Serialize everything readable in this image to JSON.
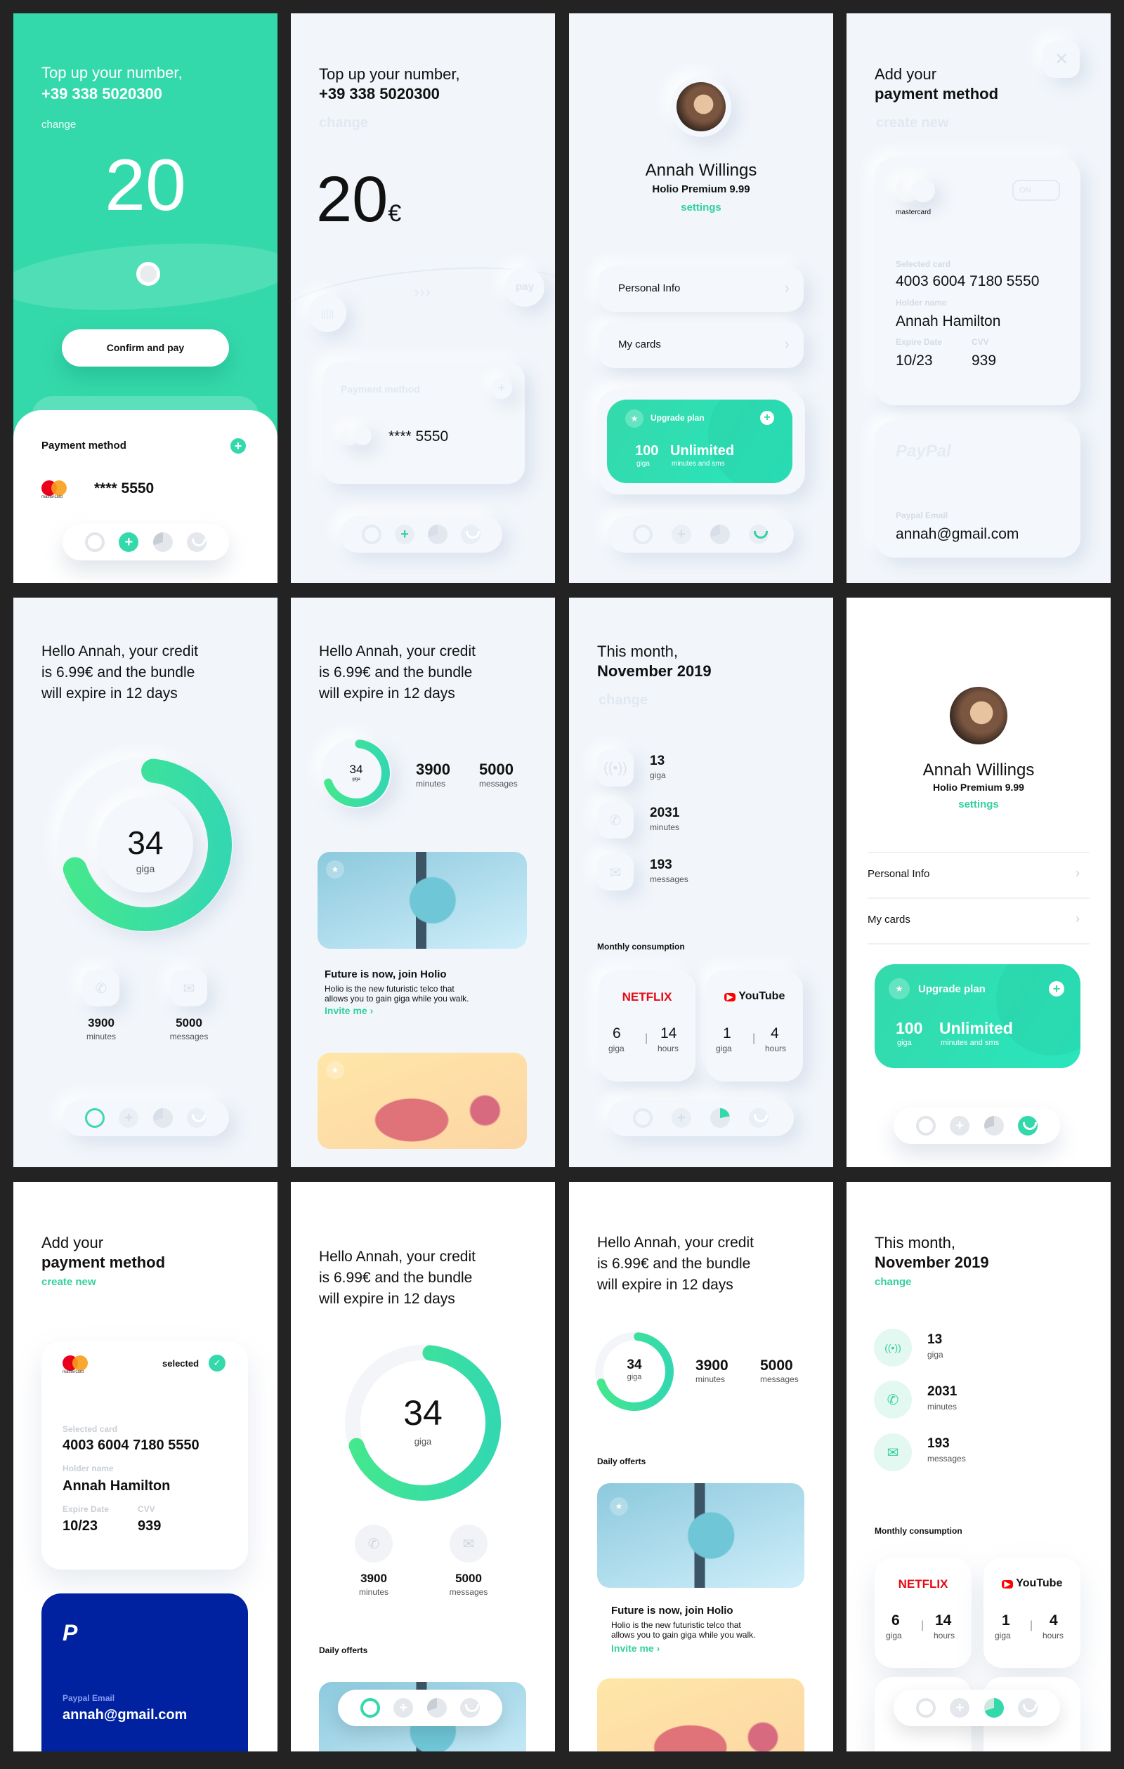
{
  "colors": {
    "accent": "#34d9ab",
    "accent_dark": "#34d0a0",
    "paypal": "#0022a0",
    "netflix": "#e50914",
    "youtube": "#ff0000",
    "background": "#f2f6fb"
  },
  "topup": {
    "title": "Top up your number,",
    "phone": "+39 338 5020300",
    "change": "change",
    "amount": "20",
    "currency": "€",
    "confirm": "Confirm and pay",
    "pay": "pay",
    "payment_method": "Payment method",
    "card_masked": "**** 5550",
    "mastercard": "mastercard"
  },
  "profile": {
    "name": "Annah Willings",
    "plan": "Holio Premium 9.99",
    "settings": "settings",
    "menu": [
      {
        "label": "Personal Info"
      },
      {
        "label": "My cards"
      }
    ],
    "upgrade": {
      "title": "Upgrade plan",
      "giga_value": "100",
      "giga_label": "giga",
      "unlimited": "Unlimited",
      "unlimited_label": "minutes and sms"
    }
  },
  "payment": {
    "title_light": "Add your",
    "title_bold": "payment method",
    "create_new": "create new",
    "mastercard": "mastercard",
    "toggle": "ON",
    "selected": "selected",
    "selected_card_label": "Selected card",
    "card_number": "4003 6004 7180 5550",
    "holder_label": "Holder name",
    "holder": "Annah Hamilton",
    "expire_label": "Expire Date",
    "expire": "10/23",
    "cvv_label": "CVV",
    "cvv": "939",
    "paypal_logo": "PayPal",
    "paypal_email_label": "Paypal Email",
    "paypal_email": "annah@gmail.com"
  },
  "home": {
    "greeting": {
      "l1": "Hello Annah, your credit",
      "l2a": "is ",
      "credit": "6.99€",
      "l2b": " and the bundle",
      "l3a": "will expire in ",
      "days": "12 days"
    },
    "giga": "34",
    "giga_label": "giga",
    "giga_fraction": 0.68,
    "minutes": "3900",
    "minutes_label": "minutes",
    "messages": "5000",
    "messages_label": "messages",
    "daily_offers": "Daily offerts",
    "offer": {
      "title": "Future is now, join Holio",
      "desc1": "Holio is the new futuristic telco that",
      "desc2": "allows you to gain giga while you walk.",
      "cta": "Invite me ›"
    }
  },
  "month": {
    "l1": "This month,",
    "l2": "November 2019",
    "change": "change",
    "stats": [
      {
        "value": "13",
        "label": "giga",
        "icon": "signal-icon"
      },
      {
        "value": "2031",
        "label": "minutes",
        "icon": "phone-icon"
      },
      {
        "value": "193",
        "label": "messages",
        "icon": "mail-icon"
      }
    ],
    "monthly": "Monthly consumption",
    "services": [
      {
        "name": "NETFLIX",
        "giga": "6",
        "hours": "14"
      },
      {
        "name": "YouTube",
        "giga": "1",
        "hours": "4"
      }
    ],
    "giga_label": "giga",
    "hours_label": "hours"
  },
  "nav": {
    "items": [
      "home",
      "add",
      "stats",
      "profile"
    ]
  }
}
